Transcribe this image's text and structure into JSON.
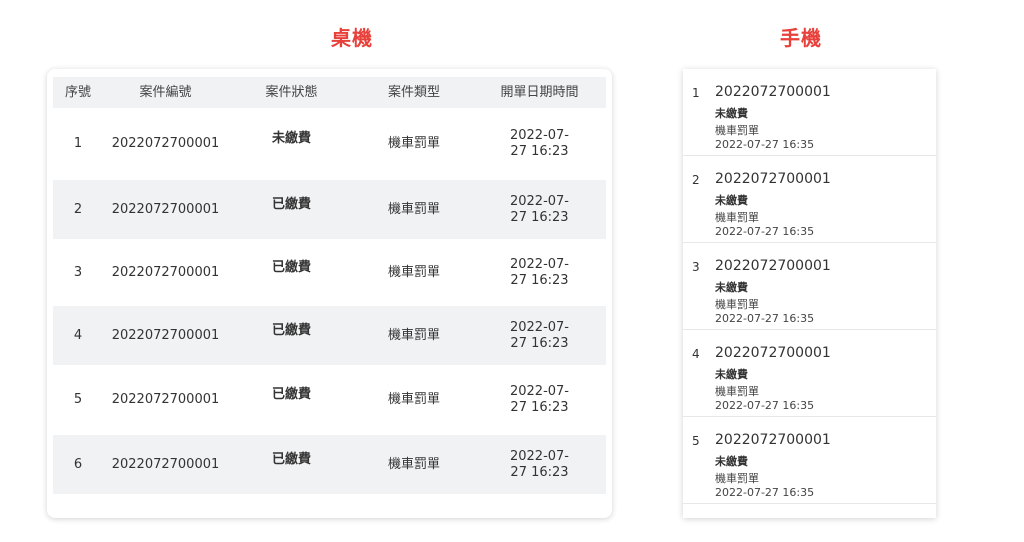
{
  "titles": {
    "desktop": "桌機",
    "mobile": "手機"
  },
  "desktop_table": {
    "headers": {
      "seq": "序號",
      "case_id": "案件編號",
      "status": "案件狀態",
      "type": "案件類型",
      "date": "開單日期時間"
    },
    "rows": [
      {
        "seq": "1",
        "case_id": "2022072700001",
        "status": "未繳費",
        "type": "機車罰單",
        "date": "2022-07-27 16:23"
      },
      {
        "seq": "2",
        "case_id": "2022072700001",
        "status": "已繳費",
        "type": "機車罰單",
        "date": "2022-07-27 16:23"
      },
      {
        "seq": "3",
        "case_id": "2022072700001",
        "status": "已繳費",
        "type": "機車罰單",
        "date": "2022-07-27 16:23"
      },
      {
        "seq": "4",
        "case_id": "2022072700001",
        "status": "已繳費",
        "type": "機車罰單",
        "date": "2022-07-27 16:23"
      },
      {
        "seq": "5",
        "case_id": "2022072700001",
        "status": "已繳費",
        "type": "機車罰單",
        "date": "2022-07-27 16:23"
      },
      {
        "seq": "6",
        "case_id": "2022072700001",
        "status": "已繳費",
        "type": "機車罰單",
        "date": "2022-07-27 16:23"
      }
    ]
  },
  "mobile_list": {
    "items": [
      {
        "seq": "1",
        "case_id": "2022072700001",
        "status": "未繳費",
        "type": "機車罰單",
        "date": "2022-07-27 16:35"
      },
      {
        "seq": "2",
        "case_id": "2022072700001",
        "status": "未繳費",
        "type": "機車罰單",
        "date": "2022-07-27 16:35"
      },
      {
        "seq": "3",
        "case_id": "2022072700001",
        "status": "未繳費",
        "type": "機車罰單",
        "date": "2022-07-27 16:35"
      },
      {
        "seq": "4",
        "case_id": "2022072700001",
        "status": "未繳費",
        "type": "機車罰單",
        "date": "2022-07-27 16:35"
      },
      {
        "seq": "5",
        "case_id": "2022072700001",
        "status": "未繳費",
        "type": "機車罰單",
        "date": "2022-07-27 16:35"
      }
    ]
  },
  "colors": {
    "accent_title": "#e8403a",
    "row_shade": "#f1f2f4"
  }
}
